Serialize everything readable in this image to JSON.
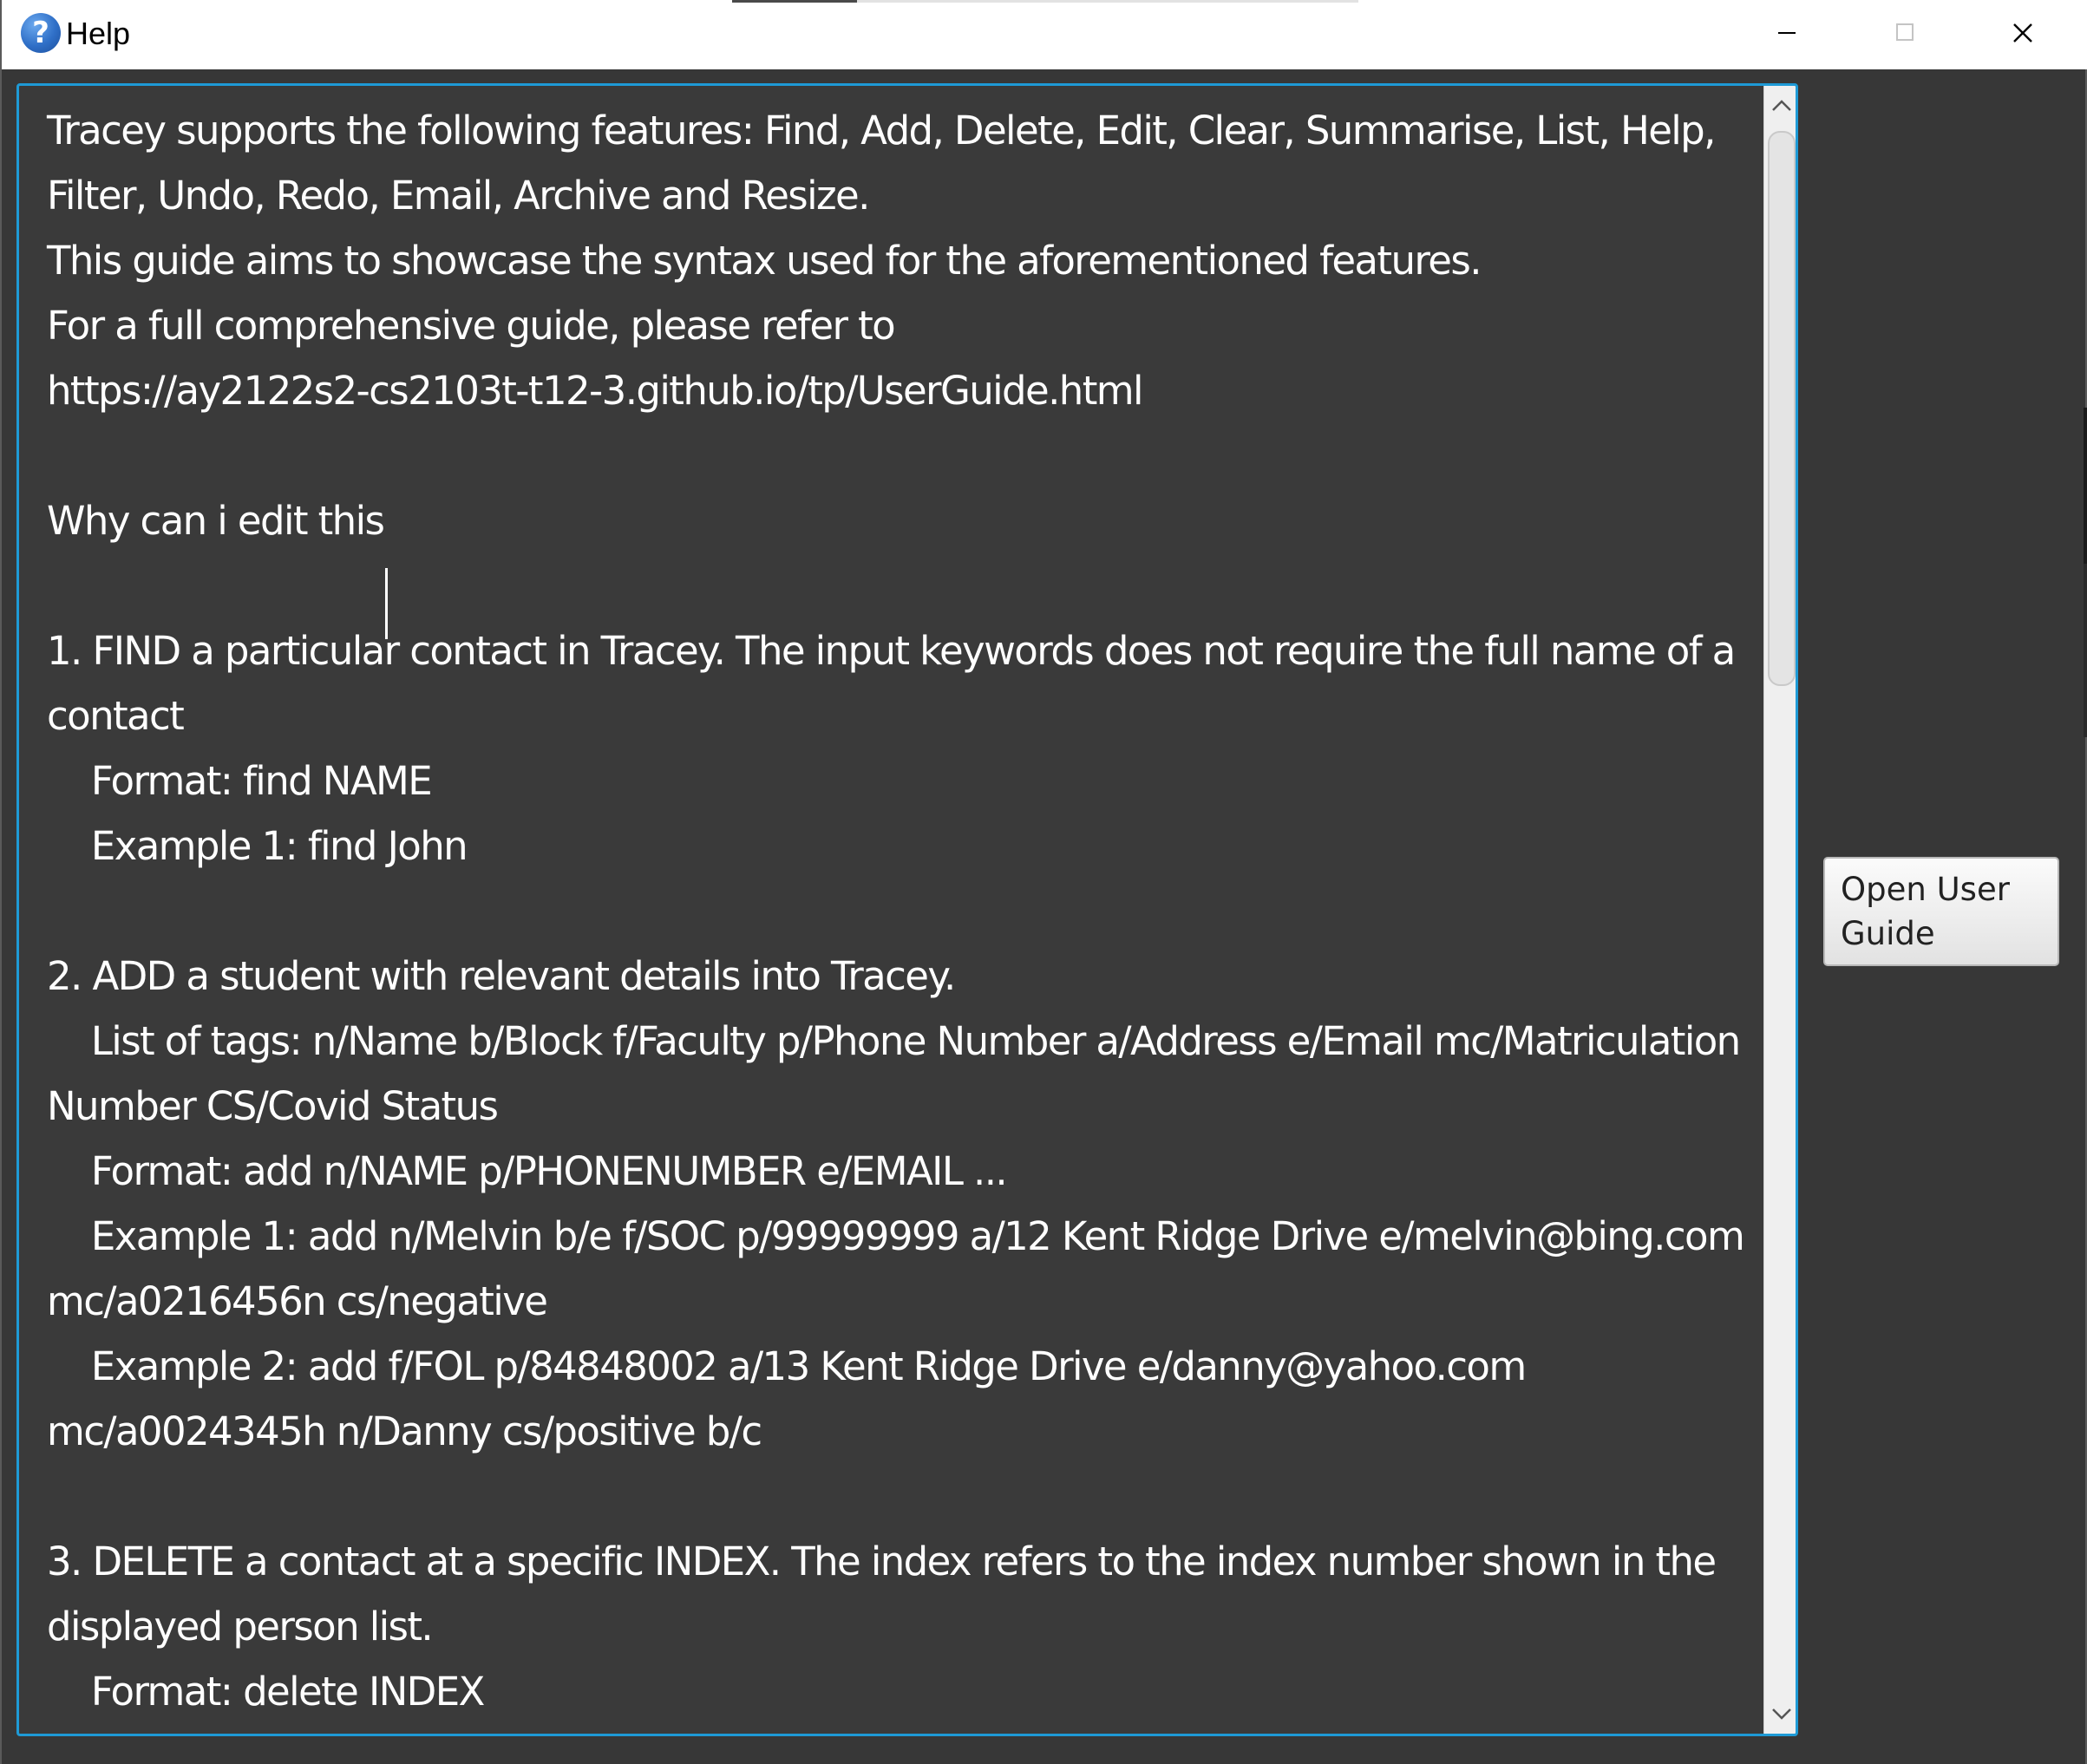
{
  "window": {
    "title": "Help",
    "icon": "help-icon",
    "controls": {
      "minimize_icon": "minimize-icon",
      "maximize_icon": "maximize-icon",
      "close_icon": "close-icon"
    }
  },
  "help_text": "Tracey supports the following features: Find, Add, Delete, Edit, Clear, Summarise, List, Help, Filter, Undo, Redo, Email, Archive and Resize.\nThis guide aims to showcase the syntax used for the aforementioned features.\nFor a full comprehensive guide, please refer to\nhttps://ay2122s2-cs2103t-t12-3.github.io/tp/UserGuide.html\n\nWhy can i edit this\n\n1. FIND a particular contact in Tracey. The input keywords does not require the full name of a contact\n    Format: find NAME\n    Example 1: find John\n\n2. ADD a student with relevant details into Tracey.\n    List of tags: n/Name b/Block f/Faculty p/Phone Number a/Address e/Email mc/Matriculation Number CS/Covid Status\n    Format: add n/NAME p/PHONENUMBER e/EMAIL ...\n    Example 1: add n/Melvin b/e f/SOC p/99999999 a/12 Kent Ridge Drive e/melvin@bing.com mc/a0216456n cs/negative\n    Example 2: add f/FOL p/84848002 a/13 Kent Ridge Drive e/danny@yahoo.com mc/a0024345h n/Danny cs/positive b/c\n\n3. DELETE a contact at a specific INDEX. The index refers to the index number shown in the displayed person list.\n    Format: delete INDEX",
  "buttons": {
    "open_user_guide": "Open User Guide"
  },
  "colors": {
    "background": "#373737",
    "text_area_background": "#3a3a3a",
    "focus_border": "#1e9ad6",
    "text": "#ffffff"
  }
}
